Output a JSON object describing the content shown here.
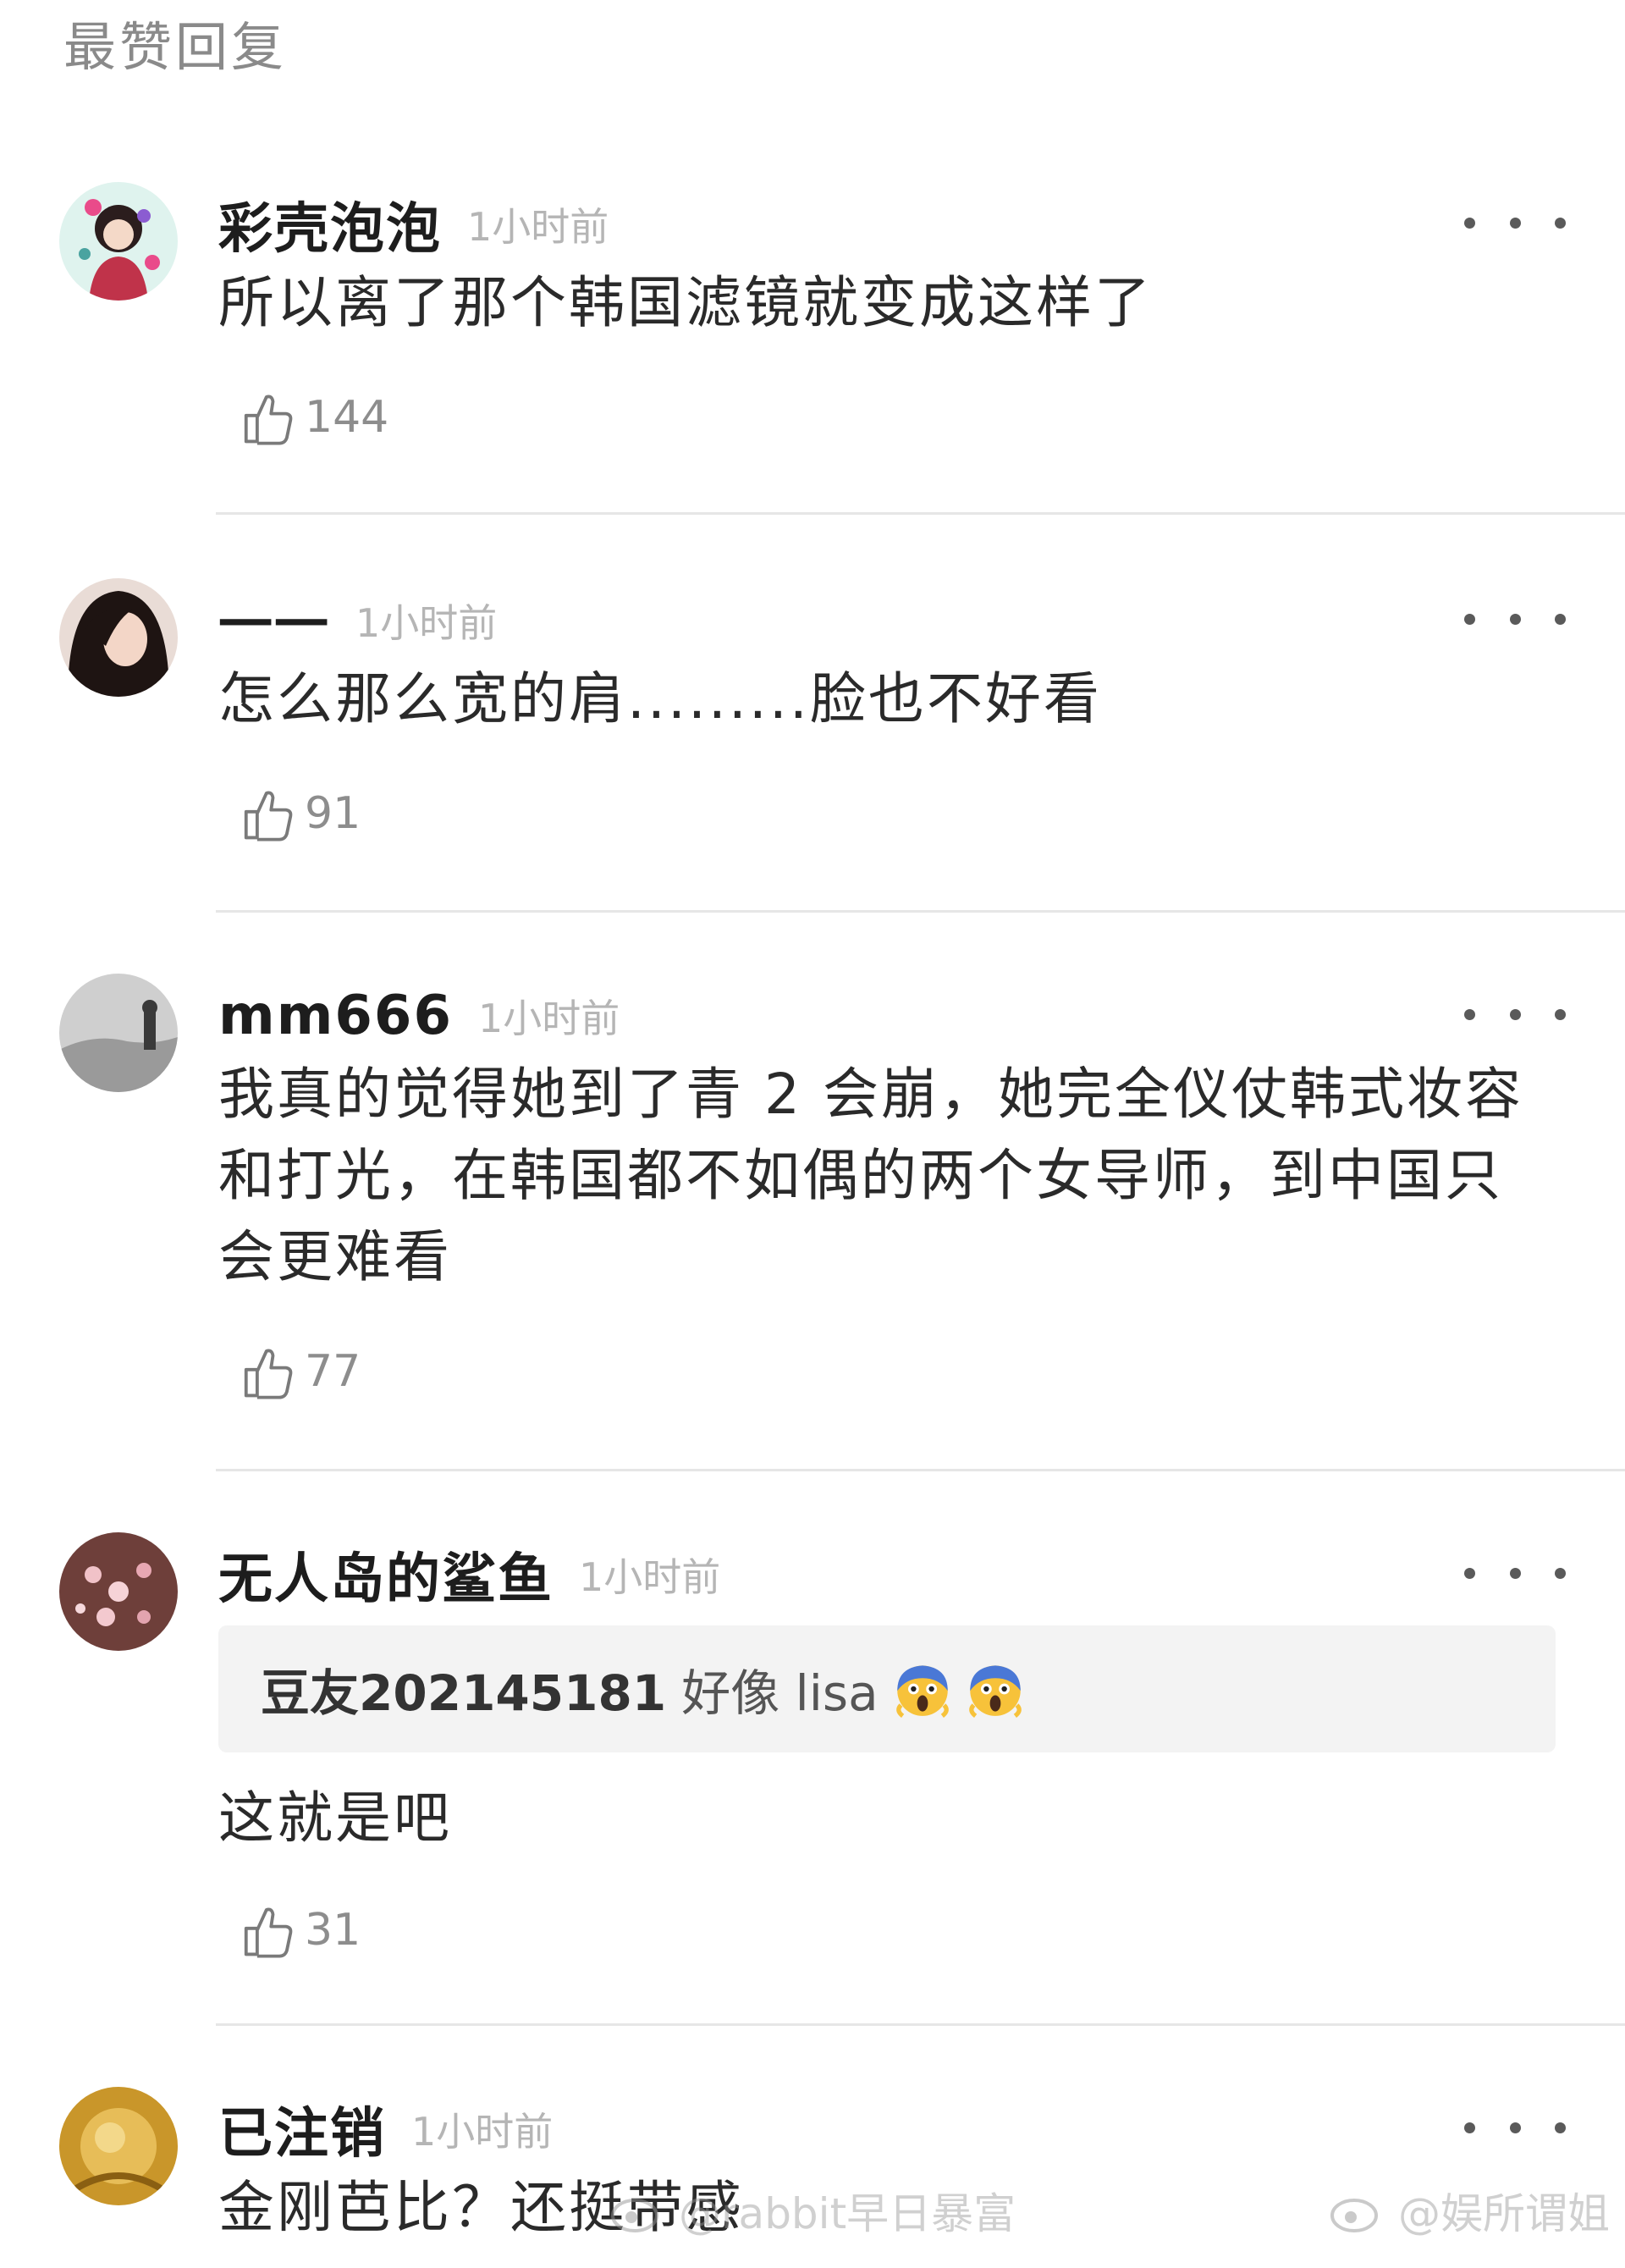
{
  "section_title": "最赞回复",
  "comments": [
    {
      "username": "彩壳泡泡",
      "time": "1小时前",
      "text": "所以离了那个韩国滤镜就变成这样了",
      "likes": "144"
    },
    {
      "username": "一一",
      "time": "1小时前",
      "text": "怎么那么宽的肩.........脸也不好看",
      "likes": "91"
    },
    {
      "username": "mm666",
      "time": "1小时前",
      "text": "我真的觉得她到了青 2 会崩，她完全仪仗韩式妆容和打光，在韩国都不如偶的两个女导师，到中国只会更难看",
      "likes": "77"
    },
    {
      "username": "无人岛的鲨鱼",
      "time": "1小时前",
      "quote_user": "豆友202145181",
      "quote_text": "好像 lisa",
      "text": "这就是吧",
      "likes": "31"
    },
    {
      "username": "已注销",
      "time": "1小时前",
      "text": "金刚芭比？还挺带感"
    }
  ],
  "icons": {
    "like": "thumbs-up-icon",
    "more": "more-dots-icon",
    "emoji": "screaming-face-emoji"
  },
  "watermarks": {
    "left": "@rabbit早日暴富",
    "right": "@娱所谓姐"
  }
}
